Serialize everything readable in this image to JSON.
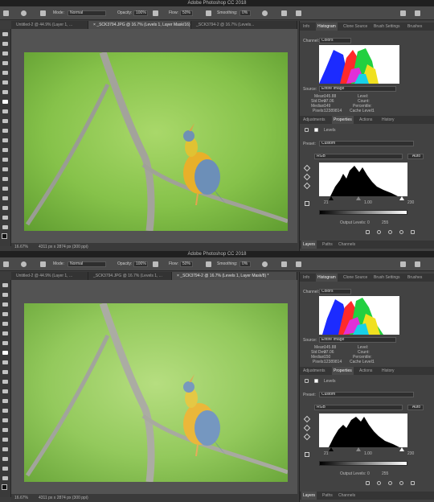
{
  "app_title": "Adobe Photoshop CC 2018",
  "optbar": {
    "mode_label": "Mode:",
    "mode_value": "Normal",
    "opacity_label": "Opacity:",
    "opacity_value": "100%",
    "flow_label": "Flow:",
    "flow_value": "50%",
    "smoothing_label": "Smoothing:",
    "smoothing_value": "0%"
  },
  "panel_tabs": [
    "Info",
    "Histogram",
    "Clone Source",
    "Brush Settings",
    "Brushes"
  ],
  "props_tabs": [
    "Adjustments",
    "Properties",
    "Actions",
    "History"
  ],
  "layers_tabs": [
    "Layers",
    "Paths",
    "Channels"
  ],
  "histogram_labels": {
    "channel_label": "Channel:",
    "channel_value": "Colors",
    "source_label": "Source:",
    "source_value": "Entire Image",
    "mean_label": "Mean:",
    "stddev_label": "Std Dev:",
    "median_label": "Median:",
    "pixels_label": "Pixels:",
    "level_label": "Level:",
    "count_label": "Count:",
    "percentile_label": "Percentile:",
    "cache_label": "Cache Level:"
  },
  "levels": {
    "title": "Levels",
    "preset_label": "Preset:",
    "preset_value": "Custom",
    "channel_value": "RGB",
    "auto_label": "Auto",
    "output_label": "Output Levels:",
    "output_black": "0",
    "output_white": "255"
  },
  "windows": [
    {
      "tabs": [
        "Untitled-2 @ 44.9% (Layer 1, ...",
        "× _SCK3794.JPG @ 16.7% (Levels 1, Layer Mask/16) *",
        "_SCK3794-2 @ 16.7% (Levels..."
      ],
      "active_tab": 1,
      "status_zoom": "16.67%",
      "status_info": "4311 px x 2874 px (300 ppi)",
      "histogram": {
        "mean": "145.88",
        "stddev": "97.06",
        "median": "149",
        "pixels": "12389814",
        "cache": "1"
      },
      "input_levels": {
        "black": "21",
        "gamma": "1.00",
        "white": "230"
      }
    },
    {
      "tabs": [
        "Untitled-2 @ 44.9% (Layer 1, ...",
        "_SCK3794.JPG @ 16.7% (Levels 1, ...",
        "× _SCK3794-2 @ 16.7% (Levels 1, Layer Mask/8) *"
      ],
      "active_tab": 2,
      "status_zoom": "16.67%",
      "status_info": "4311 px x 2874 px (300 ppi)",
      "histogram": {
        "mean": "145.88",
        "stddev": "97.06",
        "median": "150",
        "pixels": "12389814",
        "cache": "1"
      },
      "input_levels": {
        "black": "21",
        "gamma": "1.00",
        "white": "230"
      }
    }
  ]
}
